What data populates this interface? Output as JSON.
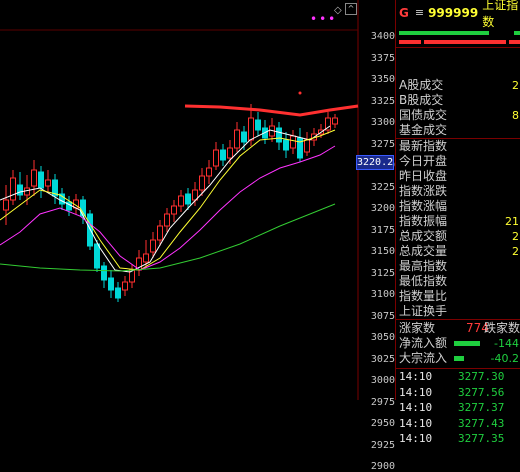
{
  "header": {
    "g_label": "G",
    "menu_icon": "menu-icon",
    "code": "999999",
    "name": "上证指数"
  },
  "chart": {
    "y_labels": [
      "3400",
      "3375",
      "3350",
      "3325",
      "3300",
      "3275",
      "3250",
      "3225",
      "3200",
      "3175",
      "3150",
      "3125",
      "3100",
      "3075",
      "3050",
      "3025",
      "3000",
      "2975",
      "2950",
      "2925",
      "2900"
    ],
    "price_tag": "3220.2",
    "top_marks": "•••",
    "colors": {
      "up": "#ff3030",
      "down": "#00d8d8",
      "ma5": "#ffffff",
      "ma10": "#ffff33",
      "ma20": "#ff33ff",
      "ma60": "#33cc33",
      "resist": "#ff3030"
    }
  },
  "stats": [
    {
      "label": "A股成交",
      "value": "2"
    },
    {
      "label": "B股成交",
      "value": ""
    },
    {
      "label": "国债成交",
      "value": "8"
    },
    {
      "label": "基金成交",
      "value": ""
    },
    {
      "label": "最新指数",
      "value": ""
    },
    {
      "label": "今日开盘",
      "value": ""
    },
    {
      "label": "昨日收盘",
      "value": ""
    },
    {
      "label": "指数涨跌",
      "value": ""
    },
    {
      "label": "指数涨幅",
      "value": ""
    },
    {
      "label": "指数振幅",
      "value": "21"
    },
    {
      "label": "总成交额",
      "value": "2"
    },
    {
      "label": "总成交量",
      "value": "2"
    },
    {
      "label": "最高指数",
      "value": ""
    },
    {
      "label": "最低指数",
      "value": ""
    },
    {
      "label": "指数量比",
      "value": ""
    },
    {
      "label": "上证换手",
      "value": ""
    }
  ],
  "updown": {
    "label_up": "涨家数",
    "count": "774",
    "label_down": "跌家数"
  },
  "flows": [
    {
      "label": "净流入额",
      "value": "-144"
    },
    {
      "label": "大宗流入",
      "value": "-40.2"
    }
  ],
  "ticks": [
    {
      "time": "14:10",
      "price": "3277.30"
    },
    {
      "time": "14:10",
      "price": "3277.56"
    },
    {
      "time": "14:10",
      "price": "3277.37"
    },
    {
      "time": "14:10",
      "price": "3277.43"
    },
    {
      "time": "14:10",
      "price": "3277.35"
    }
  ]
}
